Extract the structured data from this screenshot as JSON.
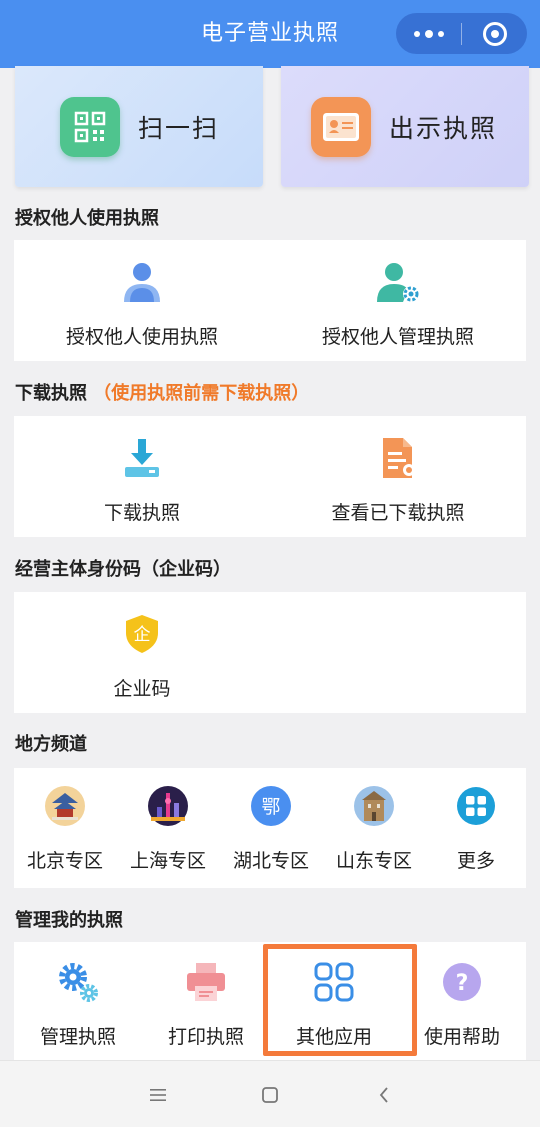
{
  "header": {
    "title": "电子营业执照"
  },
  "top": {
    "scan_label": "扫一扫",
    "show_label": "出示执照"
  },
  "authorize": {
    "title": "授权他人使用执照",
    "items": [
      {
        "label": "授权他人使用执照",
        "icon": "person-icon",
        "color": "#5b8fe8"
      },
      {
        "label": "授权他人管理执照",
        "icon": "person-gear-icon",
        "color": "#3fb8a3"
      }
    ]
  },
  "download": {
    "title": "下载执照",
    "note": "（使用执照前需下载执照）",
    "items": [
      {
        "label": "下载执照",
        "icon": "download-icon",
        "color": "#2aa7d6"
      },
      {
        "label": "查看已下载执照",
        "icon": "document-icon",
        "color": "#f39556"
      }
    ]
  },
  "enterprise": {
    "title": "经营主体身份码（企业码）",
    "items": [
      {
        "label": "企业码",
        "icon": "shield-icon",
        "glyph": "企",
        "color": "#f5c21a"
      }
    ]
  },
  "local": {
    "title": "地方频道",
    "items": [
      {
        "label": "北京专区",
        "icon": "beijing-temple-icon"
      },
      {
        "label": "上海专区",
        "icon": "shanghai-skyline-icon"
      },
      {
        "label": "湖北专区",
        "icon": "hubei-icon",
        "glyph": "鄂",
        "color": "#4a8ff0"
      },
      {
        "label": "山东专区",
        "icon": "shandong-building-icon"
      },
      {
        "label": "更多",
        "icon": "grid-icon",
        "color": "#1c9fd8"
      }
    ]
  },
  "manage": {
    "title": "管理我的执照",
    "items": [
      {
        "label": "管理执照",
        "icon": "gears-icon",
        "color": "#3a8ee6"
      },
      {
        "label": "打印执照",
        "icon": "printer-icon",
        "color": "#f08f94"
      },
      {
        "label": "其他应用",
        "icon": "apps-icon",
        "color": "#3a8ee6"
      },
      {
        "label": "使用帮助",
        "icon": "help-icon",
        "glyph": "?",
        "color": "#b7a6ee"
      }
    ]
  }
}
